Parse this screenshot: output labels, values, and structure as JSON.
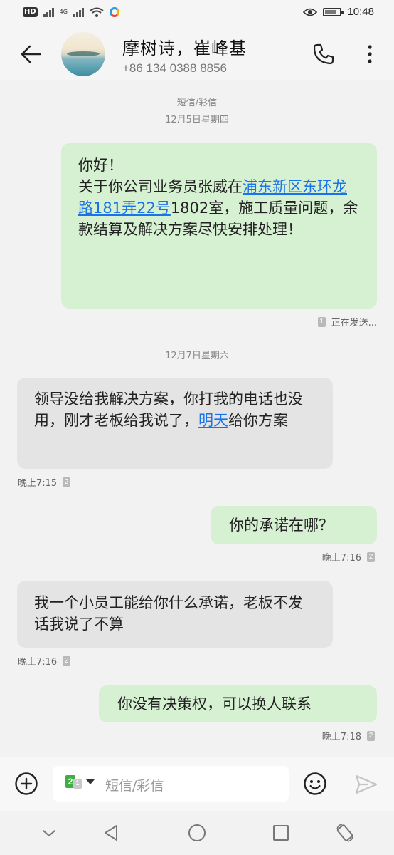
{
  "status_bar": {
    "hd_label": "HD",
    "network_label": "4G",
    "time": "10:48"
  },
  "header": {
    "contact_name": "摩树诗，崔峰基",
    "contact_phone": "+86 134 0388 8856",
    "icons": [
      "back-arrow-icon",
      "avatar",
      "phone-icon",
      "more-vertical-icon"
    ]
  },
  "conversation": {
    "thread_type": "短信/彩信",
    "date1": "12月5日星期四",
    "msg1": {
      "line1": "你好！",
      "part1": "关于你公司业务员张威在",
      "link": "浦东新区东环龙路181弄22号",
      "part2": "1802室，施工质量问题，余款结算及解决方案尽快安排处理！",
      "sim": "1",
      "status": "正在发送..."
    },
    "date2": "12月7日星期六",
    "msg2": {
      "part1": "领导没给我解决方案，你打我的电话也没用，刚才老板给我说了，",
      "link": "明天",
      "part2": "给你方案",
      "time": "晚上7:15",
      "sim": "2"
    },
    "msg3": {
      "text": "你的承诺在哪？",
      "time": "晚上7:16",
      "sim": "2"
    },
    "msg4": {
      "text": "我一个小员工能给你什么承诺，老板不发话我说了不算",
      "time": "晚上7:16",
      "sim": "2"
    },
    "msg5": {
      "text": "你没有决策权，可以换人联系",
      "time": "晚上7:18",
      "sim": "2"
    }
  },
  "input_bar": {
    "placeholder": "短信/彩信",
    "sim_primary": "2",
    "sim_secondary": "1",
    "icons": [
      "add-circle-icon",
      "emoji-icon",
      "send-icon"
    ]
  },
  "nav_bar": {
    "icons": [
      "chevron-down-icon",
      "back-triangle-icon",
      "home-circle-icon",
      "recents-square-icon",
      "rotate-icon"
    ]
  },
  "colors": {
    "outgoing_bubble": "#d6f0d2",
    "incoming_bubble": "#e4e4e4",
    "link": "#1a73e8",
    "sim2_badge": "#3cb043"
  }
}
